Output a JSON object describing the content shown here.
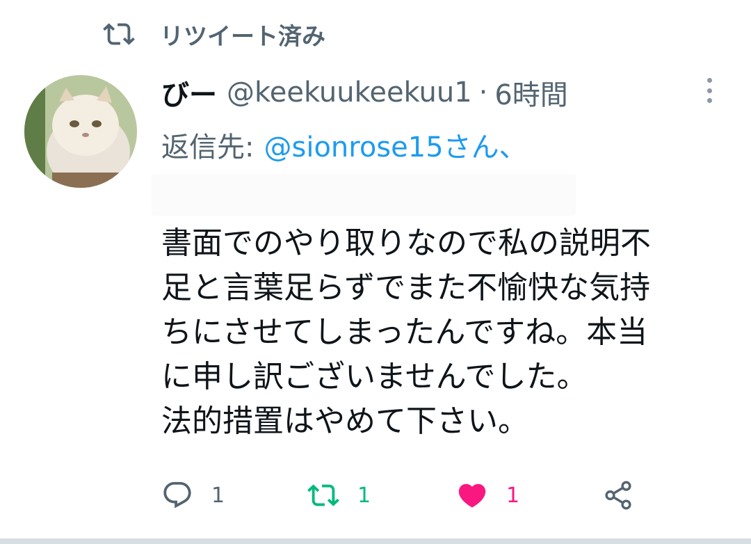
{
  "retweet_context": {
    "label": "リツイート済み",
    "icon": "retweet-icon"
  },
  "tweet": {
    "display_name": "びー",
    "handle": "@keekuukeekuu1",
    "separator": "·",
    "time": "6時間",
    "reply_prefix": "返信先:",
    "reply_mention": "@sionrose15さん、",
    "body_lines": [
      "書面でのやり取りなので私の説明不",
      "足と言葉足らずでまた不愉快な気持",
      "ちにさせてしまったんですね。本当",
      "に申し訳ございませんでした。",
      "法的措置はやめて下さい。"
    ]
  },
  "actions": {
    "reply": {
      "icon": "reply-icon",
      "count": "1"
    },
    "retweet": {
      "icon": "retweet-icon",
      "count": "1",
      "color": "#00ba7c"
    },
    "like": {
      "icon": "heart-icon",
      "count": "1",
      "color": "#f91880"
    },
    "share": {
      "icon": "share-icon"
    }
  },
  "colors": {
    "mention": "#1d9bf0",
    "muted": "#536471"
  }
}
